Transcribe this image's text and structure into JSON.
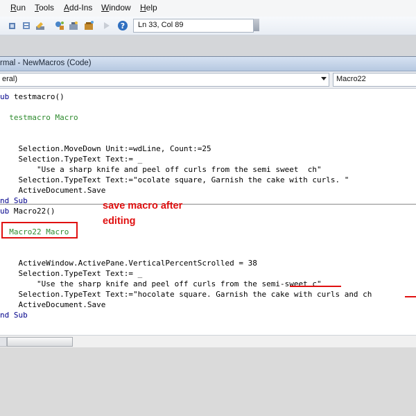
{
  "menu": {
    "items": [
      {
        "label": "Run",
        "accel": "R",
        "rest": "un"
      },
      {
        "label": "Tools",
        "accel": "T",
        "rest": "ools"
      },
      {
        "label": "Add-Ins",
        "accel": "A",
        "rest": "dd-Ins"
      },
      {
        "label": "Window",
        "accel": "W",
        "rest": "indow"
      },
      {
        "label": "Help",
        "accel": "H",
        "rest": "elp"
      }
    ]
  },
  "toolbar": {
    "icons": [
      "design-mode-icon",
      "project-explorer-icon",
      "properties-icon",
      "object-browser-icon",
      "toolbox-icon",
      "reset-icon",
      "help-icon"
    ],
    "status": "Ln 33, Col 89"
  },
  "code_window": {
    "title": "rmal - NewMacros (Code)",
    "object_combo": "eral)",
    "procedure_combo": "Macro22"
  },
  "code": {
    "lines": [
      {
        "kind": "kw",
        "kw": "ub",
        "text": " testmacro()"
      },
      {
        "kind": "cm",
        "text": "  testmacro Macro"
      },
      {
        "kind": "txt",
        "text": "    Selection.MoveDown Unit:=wdLine, Count:=25"
      },
      {
        "kind": "txt",
        "text": "    Selection.TypeText Text:= _"
      },
      {
        "kind": "txt",
        "text": "        \"Use a sharp knife and peel off curls from the semi sweet  ch\""
      },
      {
        "kind": "txt",
        "text": "    Selection.TypeText Text:=\"ocolate square, Garnish the cake with curls. \""
      },
      {
        "kind": "txt",
        "text": "    ActiveDocument.Save"
      },
      {
        "kind": "kw",
        "kw": "nd Sub",
        "text": ""
      },
      {
        "kind": "kw",
        "kw": "ub",
        "text": " Macro22()"
      },
      {
        "kind": "cm",
        "text": "  Macro22 Macro"
      },
      {
        "kind": "txt",
        "text": "    ActiveWindow.ActivePane.VerticalPercentScrolled = 38"
      },
      {
        "kind": "txt",
        "text": "    Selection.TypeText Text:= _"
      },
      {
        "kind": "txt",
        "text": "        \"Use the sharp knife and peel off curls from the semi-sweet c\""
      },
      {
        "kind": "txt",
        "text": "    Selection.TypeText Text:=\"hocolate square. Garnish the cake with curls and ch"
      },
      {
        "kind": "txt",
        "text": "    ActiveDocument.Save"
      },
      {
        "kind": "kw",
        "kw": "nd Sub",
        "text": ""
      }
    ]
  },
  "annotation": {
    "line1": "save macro after",
    "line2": "editing"
  },
  "colors": {
    "keyword": "#00008b",
    "comment": "#2e8b2e",
    "annotation": "#e01010"
  }
}
